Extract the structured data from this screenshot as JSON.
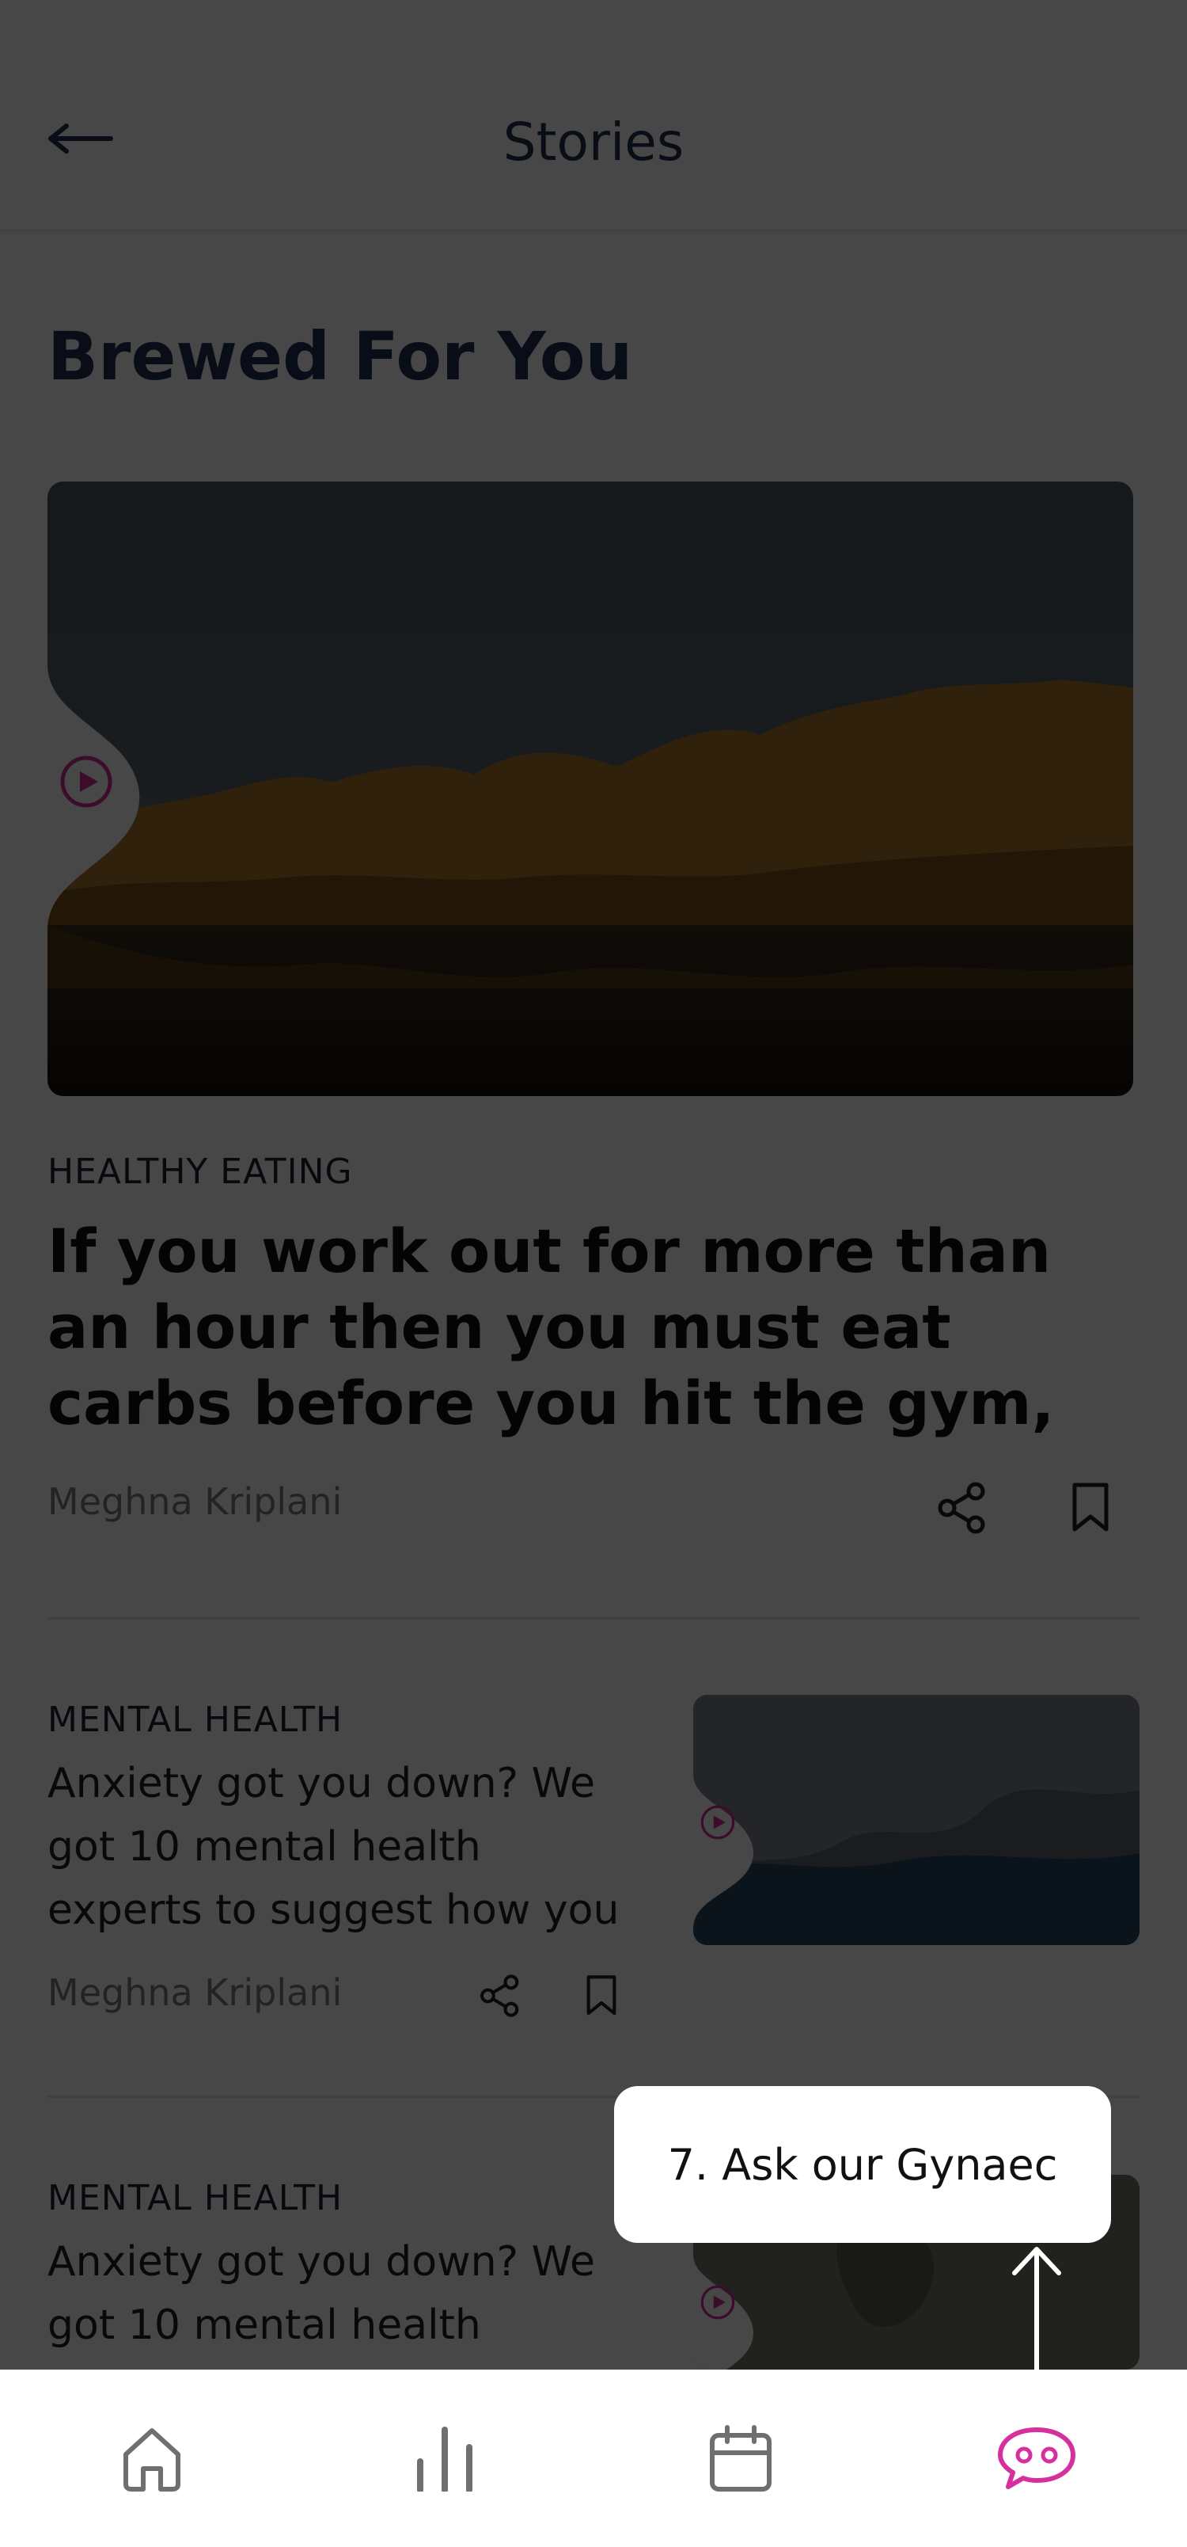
{
  "header": {
    "title": "Stories",
    "back_icon": "arrow-left-icon"
  },
  "section": {
    "title": "Brewed For You"
  },
  "hero": {
    "category": "HEALTHY EATING",
    "headline": "If you work out for more than an hour then you must eat carbs before you hit the gym,",
    "author": "Meghna Kriplani",
    "image_icon": "play-icon"
  },
  "articles": [
    {
      "category": "MENTAL HEALTH",
      "title": "Anxiety got you down? We got 10 mental health experts to suggest how you",
      "author": "Meghna Kriplani"
    },
    {
      "category": "MENTAL HEALTH",
      "title": "Anxiety got you down? We got 10 mental health"
    }
  ],
  "tooltip": {
    "text": "7. Ask our Gynaec"
  },
  "bottom_nav": {
    "items": [
      {
        "icon": "home-icon"
      },
      {
        "icon": "bar-chart-icon"
      },
      {
        "icon": "calendar-icon"
      },
      {
        "icon": "chat-bubble-icon",
        "active": true
      }
    ]
  },
  "colors": {
    "overlay": "#000000",
    "accent": "#d6309c",
    "title": "#1d2f57",
    "nav_icon": "#6f6f6f"
  }
}
